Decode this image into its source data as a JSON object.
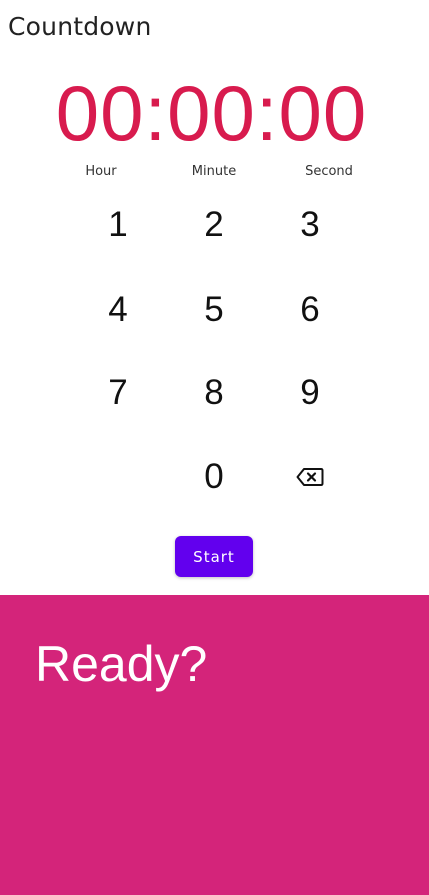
{
  "app": {
    "title": "Countdown"
  },
  "timer": {
    "display": "00:00:00",
    "labels": {
      "hour": "Hour",
      "minute": "Minute",
      "second": "Second"
    }
  },
  "keypad": {
    "keys": [
      "1",
      "2",
      "3",
      "4",
      "5",
      "6",
      "7",
      "8",
      "9",
      "0"
    ],
    "backspace_icon": "backspace-icon"
  },
  "actions": {
    "start_label": "Start"
  },
  "status": {
    "message": "Ready?"
  },
  "colors": {
    "timer": "#d81b4e",
    "start_button": "#6200ee",
    "panel": "#d4247a"
  }
}
